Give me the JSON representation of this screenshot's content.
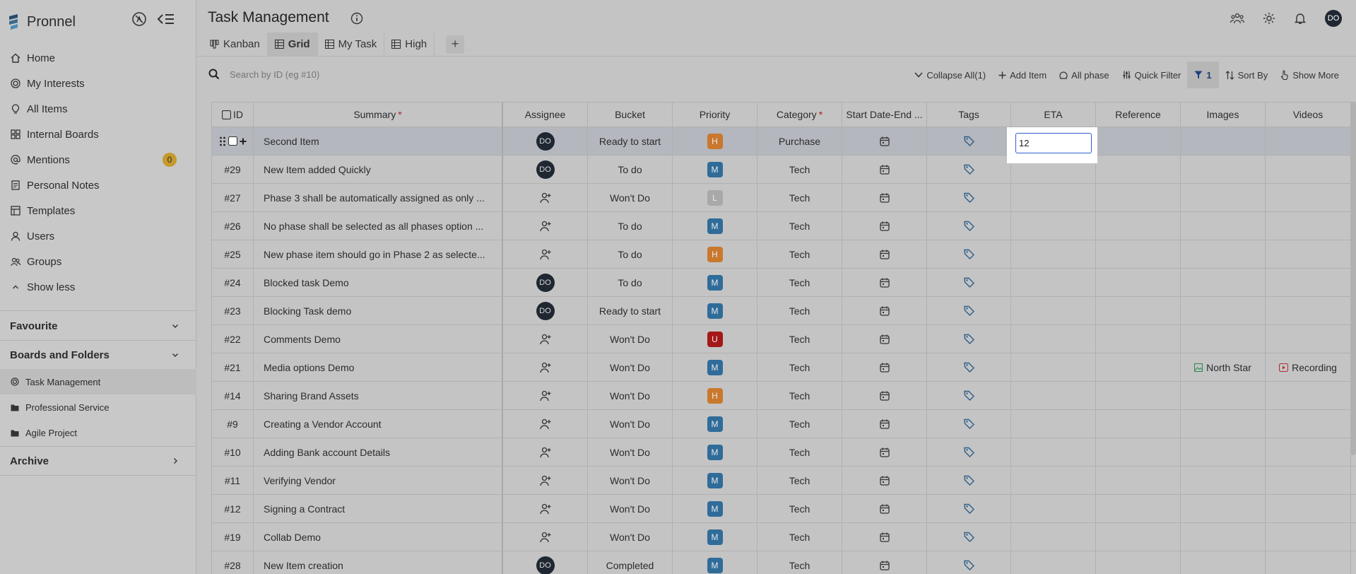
{
  "app": {
    "name": "Pronnel"
  },
  "nav": [
    {
      "label": "Home",
      "icon": "home-icon"
    },
    {
      "label": "My Interests",
      "icon": "target-icon"
    },
    {
      "label": "All Items",
      "icon": "bulb-icon"
    },
    {
      "label": "Internal Boards",
      "icon": "grid-icon"
    },
    {
      "label": "Mentions",
      "icon": "at-icon",
      "badge": "0"
    },
    {
      "label": "Personal Notes",
      "icon": "note-icon"
    },
    {
      "label": "Templates",
      "icon": "template-icon"
    },
    {
      "label": "Users",
      "icon": "user-icon"
    },
    {
      "label": "Groups",
      "icon": "group-icon"
    },
    {
      "label": "Show less",
      "icon": "chevron-up-icon"
    }
  ],
  "sections": {
    "favourite": "Favourite",
    "boards": "Boards and Folders",
    "archive": "Archive"
  },
  "folders": [
    {
      "label": "Task Management",
      "icon": "board-icon"
    },
    {
      "label": "Professional Service",
      "icon": "folder-icon"
    },
    {
      "label": "Agile Project",
      "icon": "folder-icon"
    }
  ],
  "header": {
    "title": "Task Management",
    "avatar": "DO"
  },
  "tabs": [
    {
      "label": "Kanban"
    },
    {
      "label": "Grid"
    },
    {
      "label": "My Task"
    },
    {
      "label": "High"
    }
  ],
  "tab_add": "+",
  "search": {
    "placeholder": "Search by ID (eg #10)"
  },
  "toolbar": {
    "collapse": "Collapse All(1)",
    "add_item": "Add Item",
    "all_phase": "All phase",
    "quick_filter": "Quick Filter",
    "filter_count": "1",
    "sort_by": "Sort By",
    "show_more": "Show More"
  },
  "columns": {
    "id": "ID",
    "summary": "Summary",
    "assignee": "Assignee",
    "bucket": "Bucket",
    "priority": "Priority",
    "category": "Category",
    "dates": "Start Date-End ...",
    "tags": "Tags",
    "eta": "ETA",
    "reference": "Reference",
    "images": "Images",
    "videos": "Videos"
  },
  "colors": {
    "high": "#c9782e",
    "medium": "#2f6c9a",
    "low": "#a9a9a9",
    "urgent": "#a51818"
  },
  "eta_input_value": "12",
  "rows": [
    {
      "id": "",
      "summary": "Second Item",
      "assignee": "DO",
      "bucket": "Ready to start",
      "priority": "H",
      "category": "Purchase",
      "image": "",
      "video": ""
    },
    {
      "id": "#29",
      "summary": "New Item added Quickly",
      "assignee": "DO",
      "bucket": "To do",
      "priority": "M",
      "category": "Tech",
      "image": "",
      "video": ""
    },
    {
      "id": "#27",
      "summary": "Phase 3 shall be automatically assigned as only ...",
      "assignee": "",
      "bucket": "Won't Do",
      "priority": "L",
      "category": "Tech",
      "image": "",
      "video": ""
    },
    {
      "id": "#26",
      "summary": "No phase shall be selected as all phases option ...",
      "assignee": "",
      "bucket": "To do",
      "priority": "M",
      "category": "Tech",
      "image": "",
      "video": ""
    },
    {
      "id": "#25",
      "summary": "New phase item should go in Phase 2 as selecte...",
      "assignee": "",
      "bucket": "To do",
      "priority": "H",
      "category": "Tech",
      "image": "",
      "video": ""
    },
    {
      "id": "#24",
      "summary": "Blocked task Demo",
      "assignee": "DO",
      "bucket": "To do",
      "priority": "M",
      "category": "Tech",
      "image": "",
      "video": ""
    },
    {
      "id": "#23",
      "summary": "Blocking Task demo",
      "assignee": "DO",
      "bucket": "Ready to start",
      "priority": "M",
      "category": "Tech",
      "image": "",
      "video": ""
    },
    {
      "id": "#22",
      "summary": "Comments Demo",
      "assignee": "",
      "bucket": "Won't Do",
      "priority": "U",
      "category": "Tech",
      "image": "",
      "video": ""
    },
    {
      "id": "#21",
      "summary": "Media options Demo",
      "assignee": "",
      "bucket": "Won't Do",
      "priority": "M",
      "category": "Tech",
      "image": "North Star",
      "video": "Recording"
    },
    {
      "id": "#14",
      "summary": "Sharing Brand Assets",
      "assignee": "",
      "bucket": "Won't Do",
      "priority": "H",
      "category": "Tech",
      "image": "",
      "video": ""
    },
    {
      "id": "#9",
      "summary": "Creating a Vendor Account",
      "assignee": "",
      "bucket": "Won't Do",
      "priority": "M",
      "category": "Tech",
      "image": "",
      "video": ""
    },
    {
      "id": "#10",
      "summary": "Adding Bank account Details",
      "assignee": "",
      "bucket": "Won't Do",
      "priority": "M",
      "category": "Tech",
      "image": "",
      "video": ""
    },
    {
      "id": "#11",
      "summary": "Verifying Vendor",
      "assignee": "",
      "bucket": "Won't Do",
      "priority": "M",
      "category": "Tech",
      "image": "",
      "video": ""
    },
    {
      "id": "#12",
      "summary": "Signing a Contract",
      "assignee": "",
      "bucket": "Won't Do",
      "priority": "M",
      "category": "Tech",
      "image": "",
      "video": ""
    },
    {
      "id": "#19",
      "summary": "Collab Demo",
      "assignee": "",
      "bucket": "Won't Do",
      "priority": "M",
      "category": "Tech",
      "image": "",
      "video": ""
    },
    {
      "id": "#28",
      "summary": "New Item creation",
      "assignee": "DO",
      "bucket": "Completed",
      "priority": "M",
      "category": "Tech",
      "image": "",
      "video": ""
    }
  ]
}
